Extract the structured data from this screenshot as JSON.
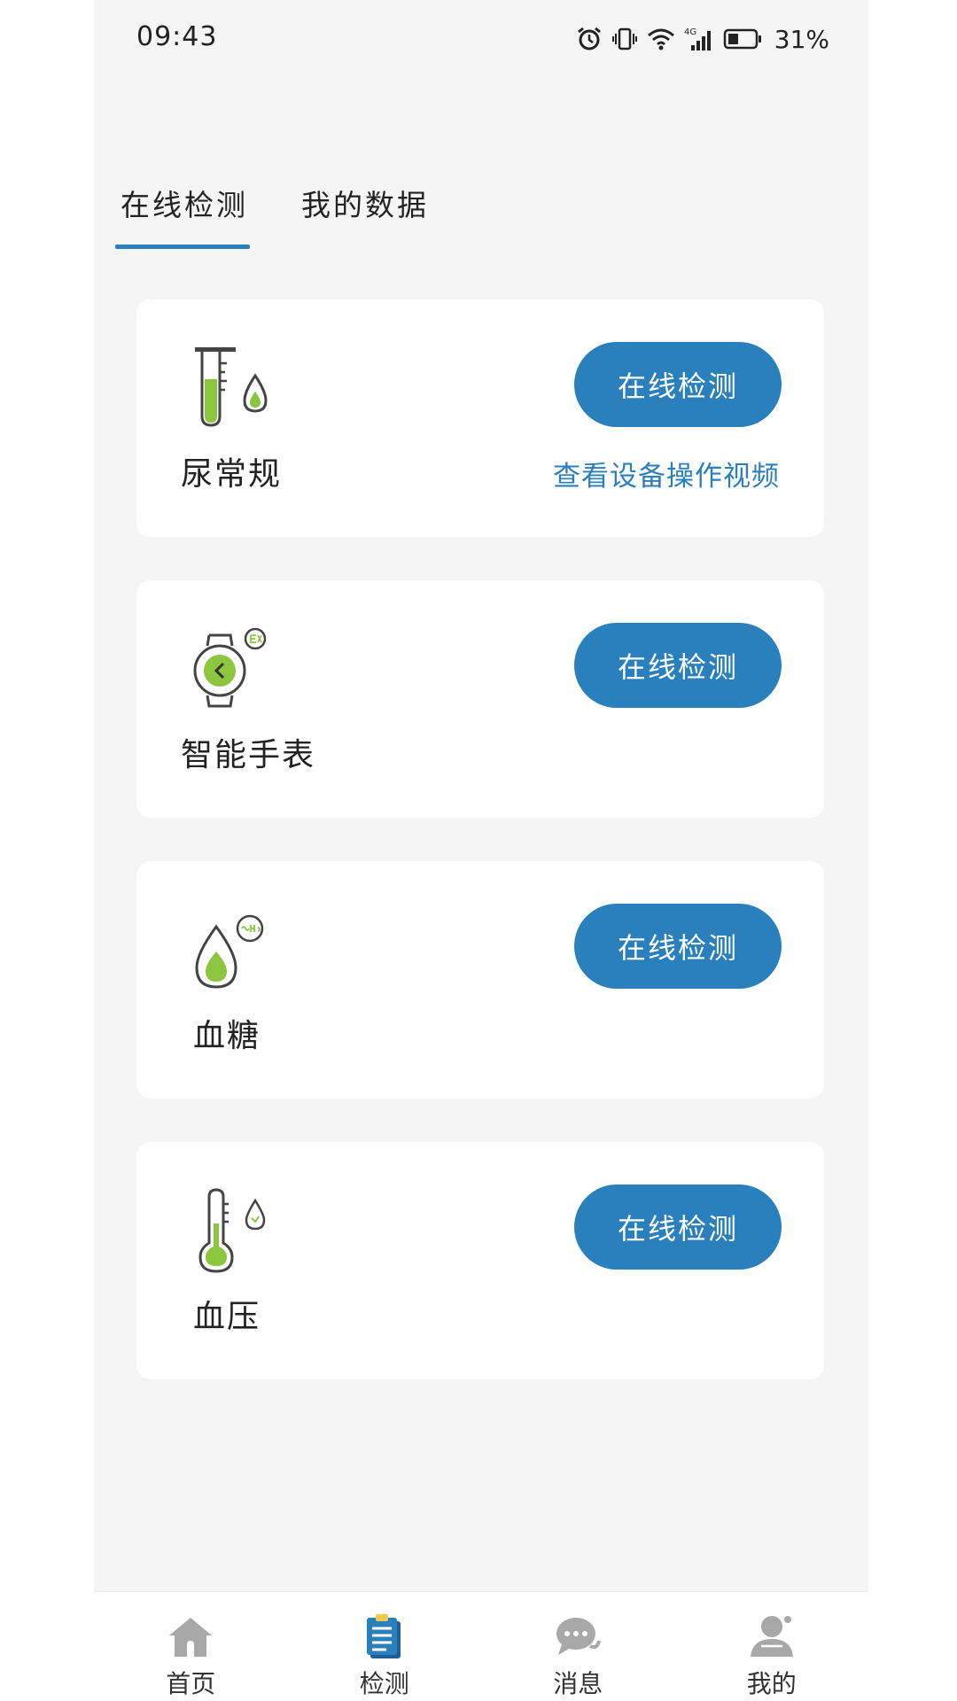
{
  "status_bar": {
    "time": "09:43",
    "battery_percent": "31%",
    "network": "4G",
    "icons": [
      "alarm-icon",
      "vibrate-icon",
      "wifi-icon",
      "cellular-signal-icon",
      "battery-icon"
    ]
  },
  "tabs": [
    {
      "label": "在线检测",
      "active": true
    },
    {
      "label": "我的数据",
      "active": false
    }
  ],
  "cards": [
    {
      "title": "尿常规",
      "icon": "test-tube-icon",
      "button_label": "在线检测",
      "link_label": "查看设备操作视频"
    },
    {
      "title": "智能手表",
      "icon": "smart-watch-icon",
      "button_label": "在线检测"
    },
    {
      "title": "血糖",
      "icon": "blood-drop-icon",
      "button_label": "在线检测"
    },
    {
      "title": "血压",
      "icon": "thermometer-icon",
      "button_label": "在线检测"
    }
  ],
  "bottom_nav": [
    {
      "label": "首页",
      "icon": "home-icon",
      "active": false
    },
    {
      "label": "检测",
      "icon": "clipboard-icon",
      "active": true
    },
    {
      "label": "消息",
      "icon": "chat-bubble-icon",
      "active": false
    },
    {
      "label": "我的",
      "icon": "user-icon",
      "active": false
    }
  ],
  "colors": {
    "primary": "#2a7fbd",
    "accent_green": "#8cc63f",
    "background": "#f5f5f5",
    "card": "#ffffff",
    "icon_gray": "#a8a8a8"
  }
}
